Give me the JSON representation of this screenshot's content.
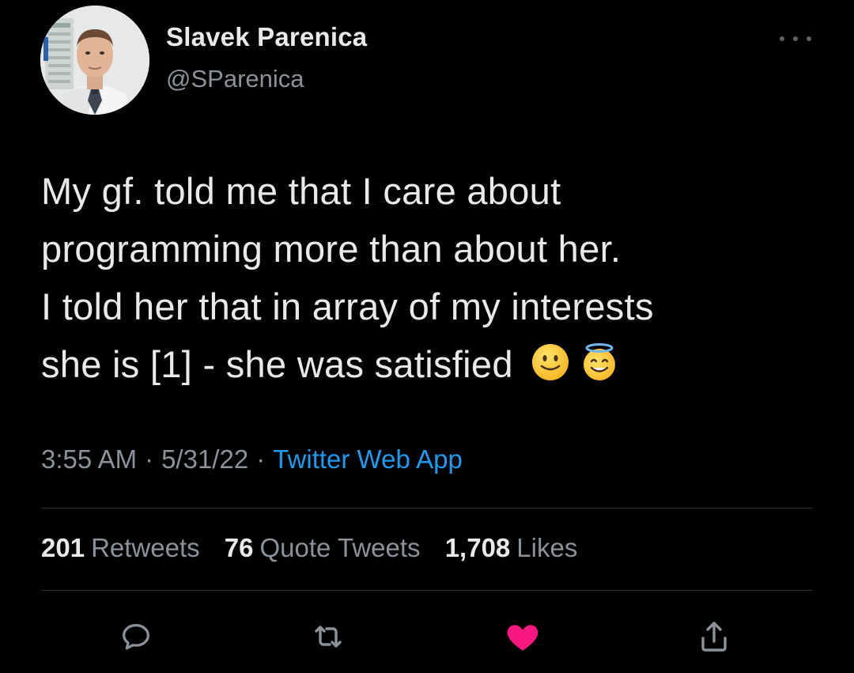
{
  "author": {
    "display_name": "Slavek Parenica",
    "handle": "@SParenica"
  },
  "tweet": {
    "lines": [
      "My gf. told me that I care about",
      "programming more than about her.",
      "I told her that in array of my interests",
      "she is [1] - she was satisfied"
    ],
    "emojis": [
      "slightly-smiling-face-emoji",
      "smiling-face-with-halo-emoji"
    ]
  },
  "meta": {
    "time": "3:55 AM",
    "separator": "·",
    "date": "5/31/22",
    "source": "Twitter Web App"
  },
  "stats": {
    "retweets_count": "201",
    "retweets_label": "Retweets",
    "quotes_count": "76",
    "quotes_label": "Quote Tweets",
    "likes_count": "1,708",
    "likes_label": "Likes"
  },
  "actions": {
    "reply_icon": "reply-icon",
    "retweet_icon": "retweet-icon",
    "like_icon": "heart-icon",
    "share_icon": "share-icon",
    "liked": true
  },
  "colors": {
    "background": "#000000",
    "text": "#e7e9ea",
    "secondary": "#8b9299",
    "link": "#1d9bf0",
    "like": "#f91880",
    "divider": "#2f3336"
  }
}
